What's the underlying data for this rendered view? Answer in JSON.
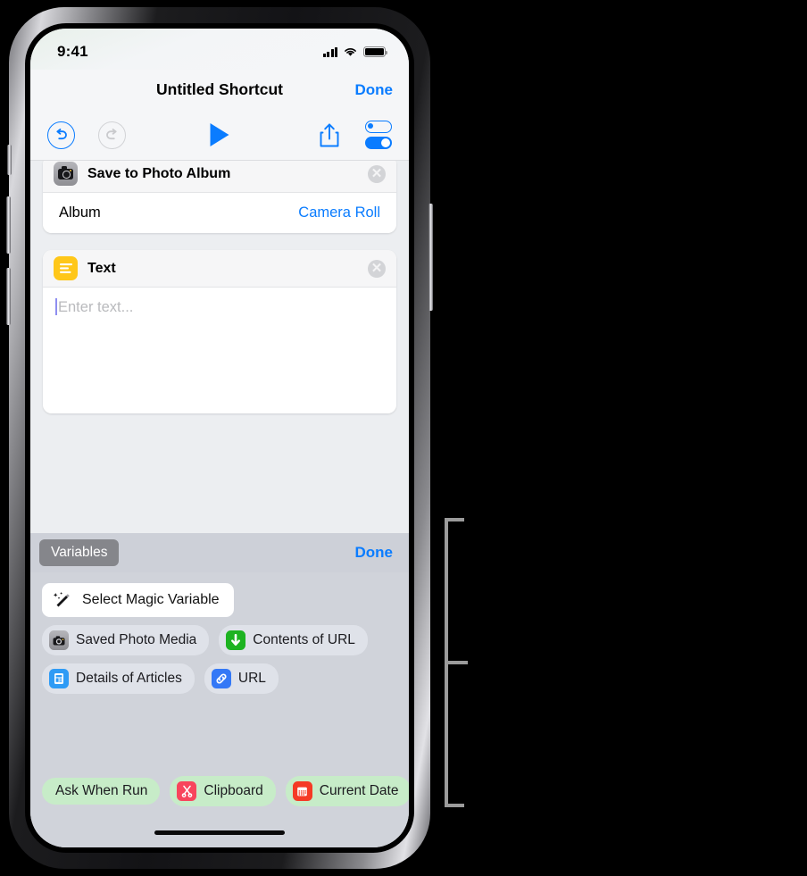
{
  "status_bar": {
    "time": "9:41",
    "signal_icon": "cellular-bars-icon",
    "wifi_icon": "wifi-icon",
    "battery_icon": "battery-icon"
  },
  "nav": {
    "title": "Untitled Shortcut",
    "done_label": "Done"
  },
  "toolbar": {
    "undo_icon": "undo-icon",
    "redo_icon": "redo-icon",
    "play_icon": "play-icon",
    "share_icon": "share-icon",
    "settings_icon": "settings-toggles-icon"
  },
  "actions": [
    {
      "title": "Save to Photo Album",
      "icon": "camera-icon",
      "icon_color": "#8e8e93",
      "remove_label": "✕",
      "rows": [
        {
          "label": "Album",
          "value": "Camera Roll"
        }
      ]
    },
    {
      "title": "Text",
      "icon": "text-lines-icon",
      "icon_color": "#ffc719",
      "remove_label": "✕",
      "placeholder": "Enter text..."
    }
  ],
  "variables_panel": {
    "tab_label": "Variables",
    "done_label": "Done",
    "magic_button": {
      "label": "Select Magic Variable",
      "icon": "magic-wand-icon"
    },
    "magic_variables": [
      {
        "label": "Saved Photo Media",
        "icon": "camera-icon",
        "icon_color": "#8e8e93"
      },
      {
        "label": "Contents of URL",
        "icon": "download-arrow-icon",
        "icon_color": "#1db321"
      },
      {
        "label": "Details of Articles",
        "icon": "document-icon",
        "icon_color": "#2f9bf5"
      },
      {
        "label": "URL",
        "icon": "link-icon",
        "icon_color": "#3478f6"
      }
    ],
    "special_variables": [
      {
        "label": "Ask When Run",
        "icon": "none",
        "icon_color": ""
      },
      {
        "label": "Clipboard",
        "icon": "scissors-icon",
        "icon_color": "#f8455c"
      },
      {
        "label": "Current Date",
        "icon": "calendar-icon",
        "icon_color": "#f53a25"
      }
    ]
  },
  "device": {
    "home_indicator": "home-indicator",
    "notch": "notch",
    "speaker": "speaker-grille",
    "front_camera": "front-camera"
  },
  "annotation": {
    "callout_bracket": "callout-bracket"
  },
  "colors": {
    "accent": "#0a7cff",
    "panel_bg": "#d0d3da",
    "screen_bg": "#eceef1",
    "green_pill": "#c7ecc8"
  }
}
